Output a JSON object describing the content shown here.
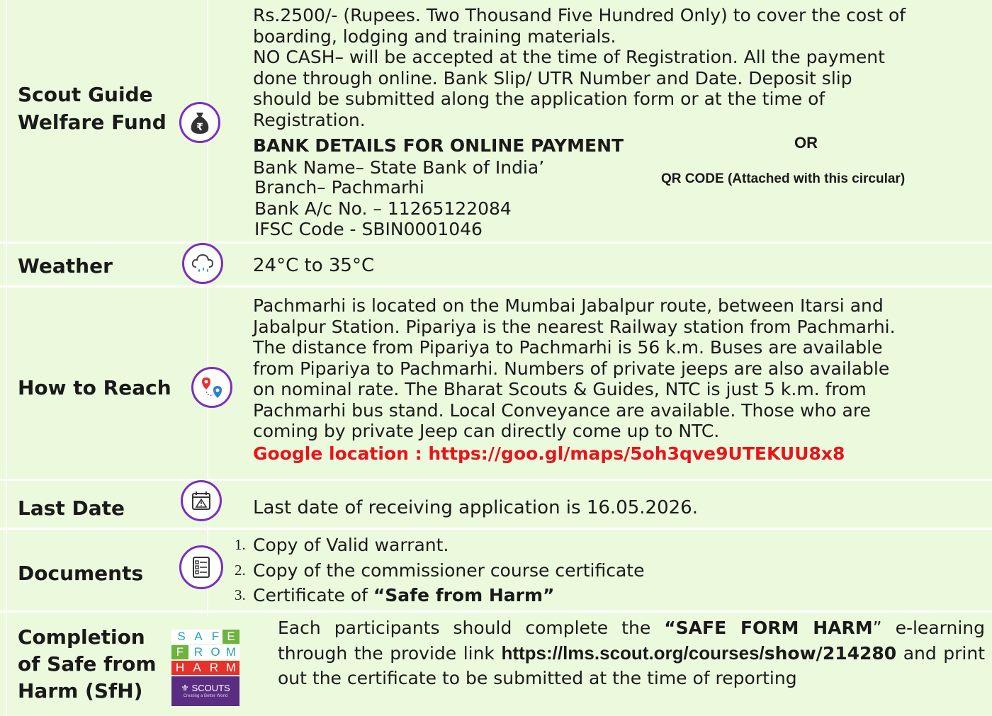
{
  "fund": {
    "label": "Scout Guide Welfare Fund",
    "line1": "Rs.2500/- (Rupees. Two Thousand Five Hundred Only) to cover the cost of",
    "line2": "boarding, lodging and training materials.",
    "line3": "NO CASH– will be accepted at the time of Registration. All the payment",
    "line4": "done through online. Bank Slip/ UTR Number and Date. Deposit slip",
    "line5": "should be submitted along the application form or at the time of",
    "line6": "Registration.",
    "bank_heading": "BANK DETAILS FOR ONLINE PAYMENT",
    "or": "OR",
    "bank_name": "Bank Name– State Bank of India’",
    "branch": "Branch– Pachmarhi",
    "account": "Bank A/c No. – 11265122084",
    "ifsc": "IFSC Code - SBIN0001046",
    "qr_note": "QR CODE (Attached with this circular)",
    "icon": "money-bag-rupee-icon"
  },
  "weather": {
    "label": "Weather",
    "value": "24°C to 35°C",
    "icon": "cloud-rain-icon"
  },
  "reach": {
    "label": "How to Reach",
    "line1": "Pachmarhi is located on the Mumbai Jabalpur route, between Itarsi and",
    "line2": "Jabalpur Station. Pipariya is the nearest Railway station from Pachmarhi.",
    "line3": "The distance from Pipariya to Pachmarhi is 56 k.m. Buses are available",
    "line4": "from Pipariya to Pachmarhi. Numbers of private jeeps are also available",
    "line5": "on nominal rate. The Bharat Scouts & Guides, NTC is just 5 k.m. from",
    "line6": "Pachmarhi bus stand. Local Conveyance are available. Those who are",
    "line7": "coming by private Jeep can directly come up to NTC.",
    "google": "Google location : https://goo.gl/maps/5oh3qve9UTEKUU8x8",
    "icon": "route-map-pin-icon"
  },
  "last_date": {
    "label": "Last Date",
    "value": "Last date of receiving application is 16.05.2026.",
    "icon": "calendar-alert-icon"
  },
  "documents": {
    "label": "Documents",
    "icon": "checklist-icon",
    "items": [
      {
        "num": "1.",
        "text": "Copy of Valid warrant.",
        "bold": ""
      },
      {
        "num": "2.",
        "text": "Copy of the commissioner course certificate",
        "bold": ""
      },
      {
        "num": "3.",
        "text": "Certificate of ",
        "bold": "“Safe from Harm”"
      }
    ]
  },
  "sfh": {
    "label_line1": "Completion",
    "label_line2": "of Safe from",
    "label_line3": "Harm (SfH)",
    "logo": {
      "row1": [
        "S",
        "A",
        "F",
        "E"
      ],
      "row2": [
        "F",
        "R",
        "O",
        "M"
      ],
      "row3": [
        "H",
        "A",
        "R",
        "M"
      ],
      "brand": "SCOUTS",
      "tagline": "Creating a Better World"
    },
    "text_a": "Each participants should complete the ",
    "text_b": "“SAFE FORM HARM",
    "text_c": "” e-learning through the provide link ",
    "link": "https://lms.scout.org/courses/",
    "link_b": "show/214280",
    "text_d": " and print out the certificate to be submitted at the time of reporting"
  },
  "colors": {
    "cell_bg": "#ebf9dd",
    "icon_ring": "#7b2fbf",
    "link_red": "#e8141b",
    "sfh_purple": "#5a2d82",
    "sfh_red": "#e5322d",
    "sfh_teal": "#1fa3b5",
    "sfh_green": "#6db33f"
  }
}
